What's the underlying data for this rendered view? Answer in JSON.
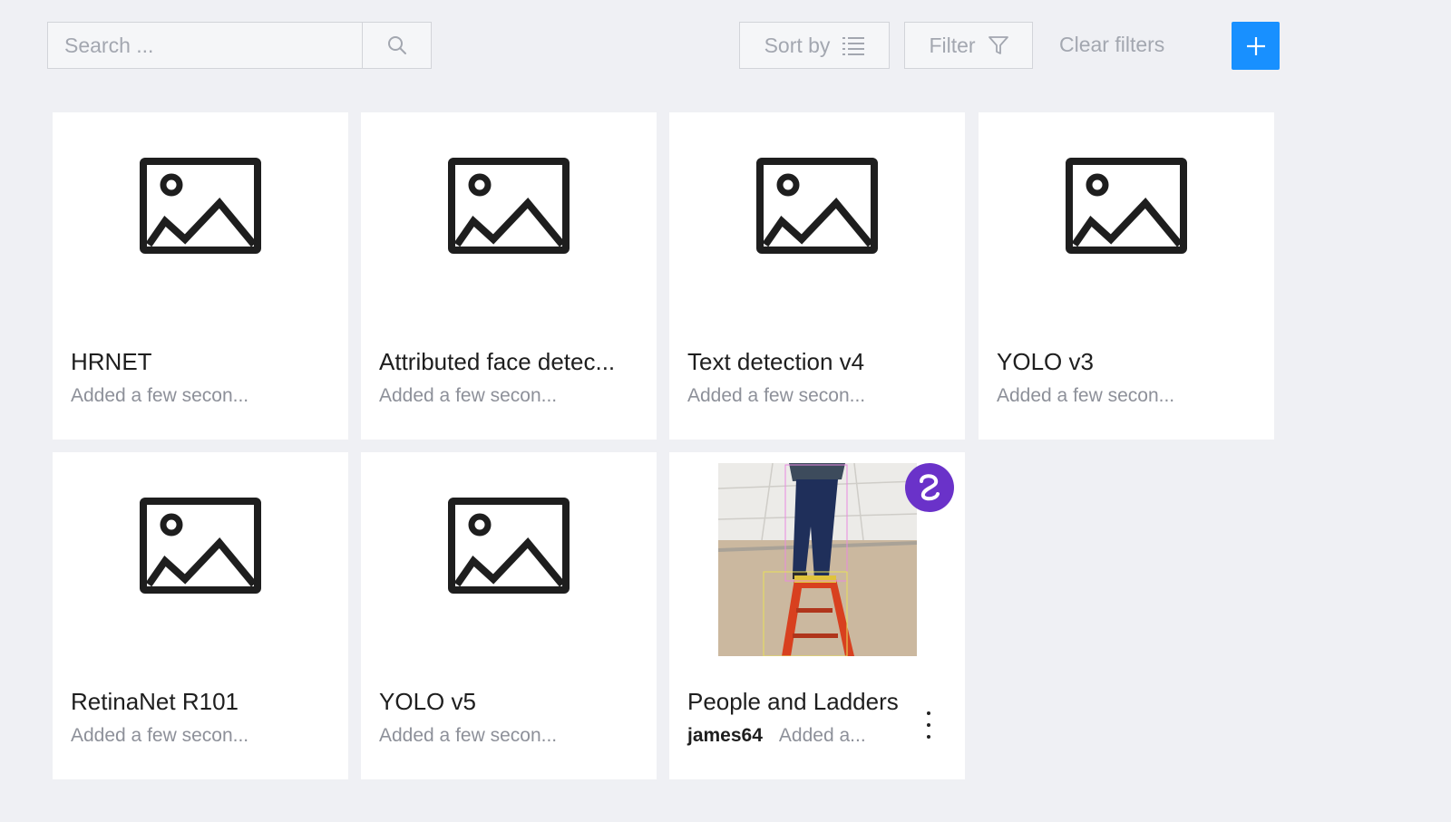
{
  "toolbar": {
    "search_placeholder": "Search ...",
    "sort_label": "Sort by",
    "filter_label": "Filter",
    "clear_filters_label": "Clear filters",
    "add_icon": "plus-icon",
    "accent_color": "#1890ff"
  },
  "cards": [
    {
      "title": "HRNET",
      "subtitle": "Added a few secon...",
      "thumbnail": "image-placeholder-icon"
    },
    {
      "title": "Attributed face detec...",
      "subtitle": "Added a few secon...",
      "thumbnail": "image-placeholder-icon"
    },
    {
      "title": "Text detection v4",
      "subtitle": "Added a few secon...",
      "thumbnail": "image-placeholder-icon"
    },
    {
      "title": "YOLO v3",
      "subtitle": "Added a few secon...",
      "thumbnail": "image-placeholder-icon"
    },
    {
      "title": "RetinaNet R101",
      "subtitle": "Added a few secon...",
      "thumbnail": "image-placeholder-icon"
    },
    {
      "title": "YOLO v5",
      "subtitle": "Added a few secon...",
      "thumbnail": "image-placeholder-icon"
    },
    {
      "title": "People and Ladders",
      "owner": "james64",
      "subtitle": "Added a...",
      "thumbnail": "photo-person-on-ladder",
      "badge": "logo-badge-icon",
      "badge_color": "#6a32c9"
    }
  ]
}
